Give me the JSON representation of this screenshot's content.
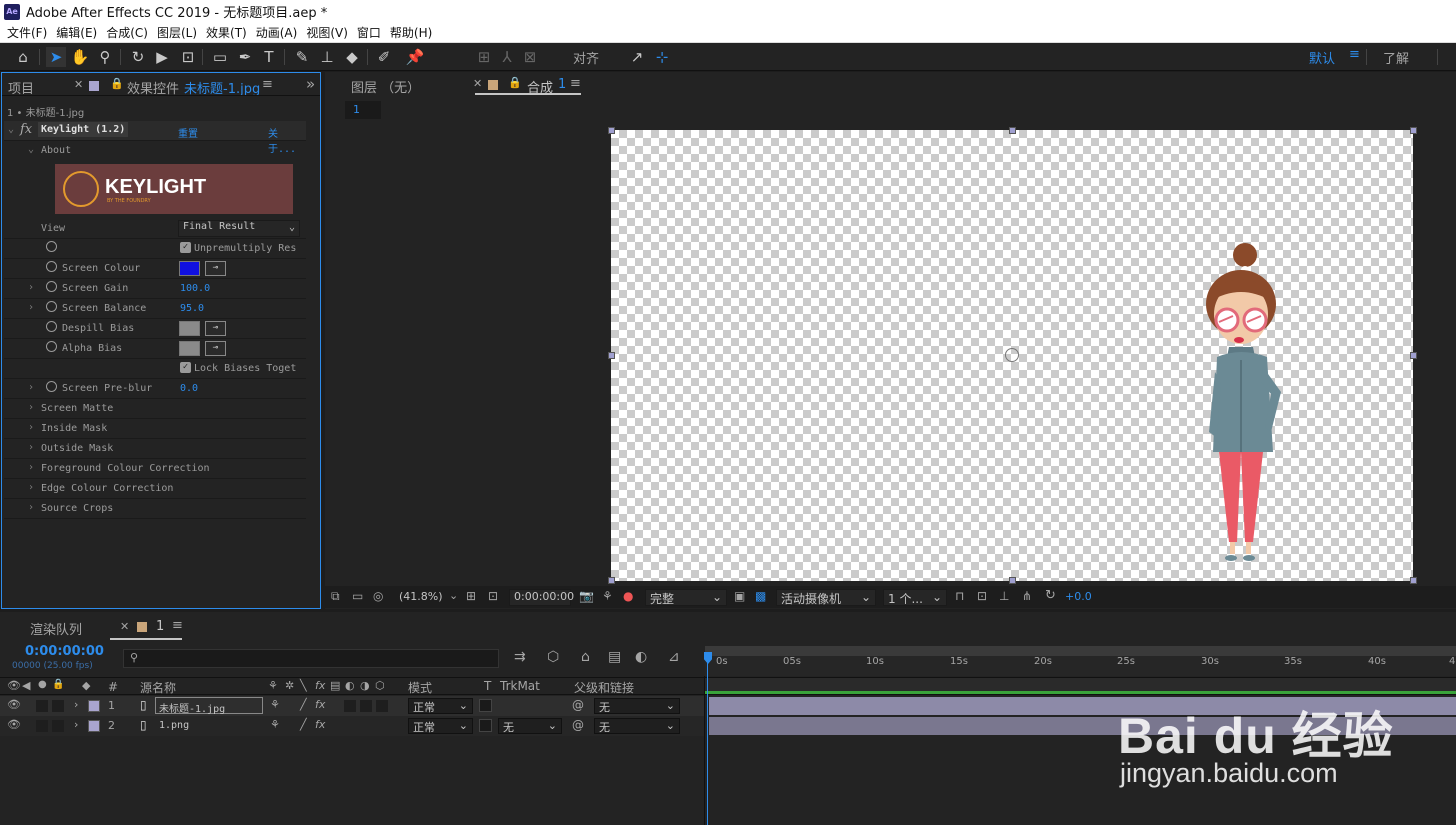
{
  "window": {
    "title": "Adobe After Effects CC 2019 - 无标题项目.aep *",
    "app_icon": "Ae"
  },
  "menu": [
    "文件(F)",
    "编辑(E)",
    "合成(C)",
    "图层(L)",
    "效果(T)",
    "动画(A)",
    "视图(V)",
    "窗口",
    "帮助(H)"
  ],
  "toolbar": {
    "snap_label": "对齐",
    "workspace": "默认",
    "learn": "了解"
  },
  "project_panel": {
    "tab_project": "项目",
    "tab_effects": "效果控件",
    "effects_target": "未标题-1.jpg",
    "breadcrumb": "1 • 未标题-1.jpg"
  },
  "effect": {
    "fx_symbol": "fx",
    "name": "Keylight (1.2)",
    "reset": "重置",
    "about_link": "关于...",
    "about": "About",
    "logo_text": "KEYLIGHT",
    "logo_sub": "BY THE FOUNDRY",
    "view_label": "View",
    "view_value": "Final Result",
    "unpremultiply": "Unpremultiply Res",
    "screen_colour": "Screen Colour",
    "screen_colour_hex": "#1010e0",
    "screen_gain": "Screen Gain",
    "screen_gain_value": "100.0",
    "screen_balance": "Screen Balance",
    "screen_balance_value": "95.0",
    "despill_bias": "Despill Bias",
    "alpha_bias": "Alpha Bias",
    "lock_biases": "Lock Biases Toget",
    "screen_preblur": "Screen Pre-blur",
    "screen_preblur_value": "0.0",
    "groups": [
      "Screen Matte",
      "Inside Mask",
      "Outside Mask",
      "Foreground Colour Correction",
      "Edge Colour Correction",
      "Source Crops"
    ]
  },
  "viewer": {
    "tab_layer": "图层 （无）",
    "tab_comp": "合成",
    "comp_name": "1",
    "breadcrumb": "1",
    "zoom": "(41.8%)",
    "timecode": "0:00:00:00",
    "resolution": "完整",
    "camera": "活动摄像机",
    "views": "1 个...",
    "exposure": "+0.0"
  },
  "timeline": {
    "tab_render": "渲染队列",
    "tab_comp": "1",
    "current_time": "0:00:00:00",
    "frame_info": "00000 (25.00 fps)",
    "search_placeholder": "",
    "col_hash": "#",
    "col_source": "源名称",
    "col_mode": "模式",
    "col_t": "T",
    "col_trkmat": "TrkMat",
    "col_parent": "父级和链接",
    "ticks": [
      "0s",
      "05s",
      "10s",
      "15s",
      "20s",
      "25s",
      "30s",
      "35s",
      "40s",
      "4"
    ],
    "layers": [
      {
        "num": "1",
        "name": "未标题-1.jpg",
        "mode": "正常",
        "trkmat": "",
        "parent": "无",
        "color": "#a9a5cf"
      },
      {
        "num": "2",
        "name": "1.png",
        "mode": "正常",
        "trkmat": "无",
        "parent": "无",
        "color": "#a9a5cf"
      }
    ]
  },
  "watermark": {
    "brand": "Bai du 经验",
    "url": "jingyan.baidu.com"
  },
  "colors": {
    "accent": "#2d8ceb",
    "panel": "#232323",
    "background": "#1d1d1d"
  }
}
